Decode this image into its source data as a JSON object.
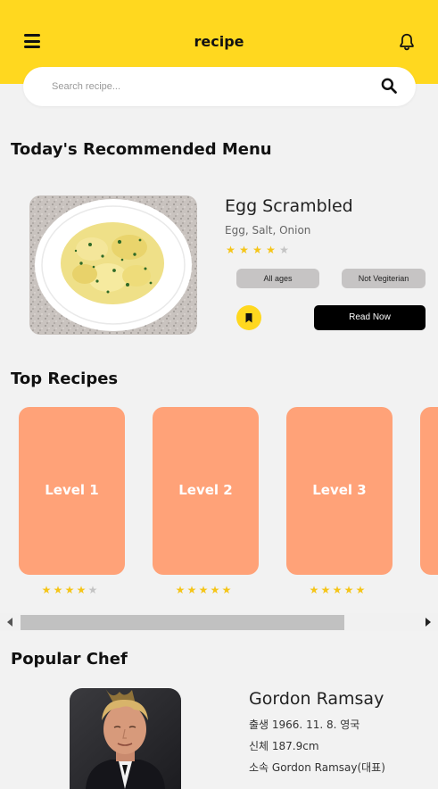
{
  "header": {
    "title": "recipe",
    "menu_icon": "hamburger-menu-icon",
    "bell_icon": "bell-icon",
    "background_color": "#ffd81f"
  },
  "search": {
    "placeholder": "Search recipe...",
    "value": "",
    "icon": "search-icon"
  },
  "recommended": {
    "section_title": "Today's Recommended Menu",
    "recipe_name": "Egg Scrambled",
    "ingredients": "Egg, Salt, Onion",
    "rating": 4,
    "rating_max": 5,
    "tags": [
      "All ages",
      "Not Vegiterian"
    ],
    "bookmark_icon": "bookmark-icon",
    "read_button": "Read Now"
  },
  "top_recipes": {
    "section_title": "Top Recipes",
    "card_color": "#ffa278",
    "cards": [
      {
        "label": "Level 1",
        "rating": 4
      },
      {
        "label": "Level 2",
        "rating": 5
      },
      {
        "label": "Level 3",
        "rating": 5
      }
    ]
  },
  "popular_chef": {
    "section_title": "Popular Chef",
    "name": "Gordon Ramsay",
    "birth": "출생 1966. 11. 8. 영국",
    "body": "신체 187.9cm",
    "agency": "소속 Gordon Ramsay(대표)"
  },
  "colors": {
    "accent": "#ffd81f",
    "star_on": "#f5c518",
    "star_off": "#c4c4c4",
    "button_dark": "#000000"
  }
}
